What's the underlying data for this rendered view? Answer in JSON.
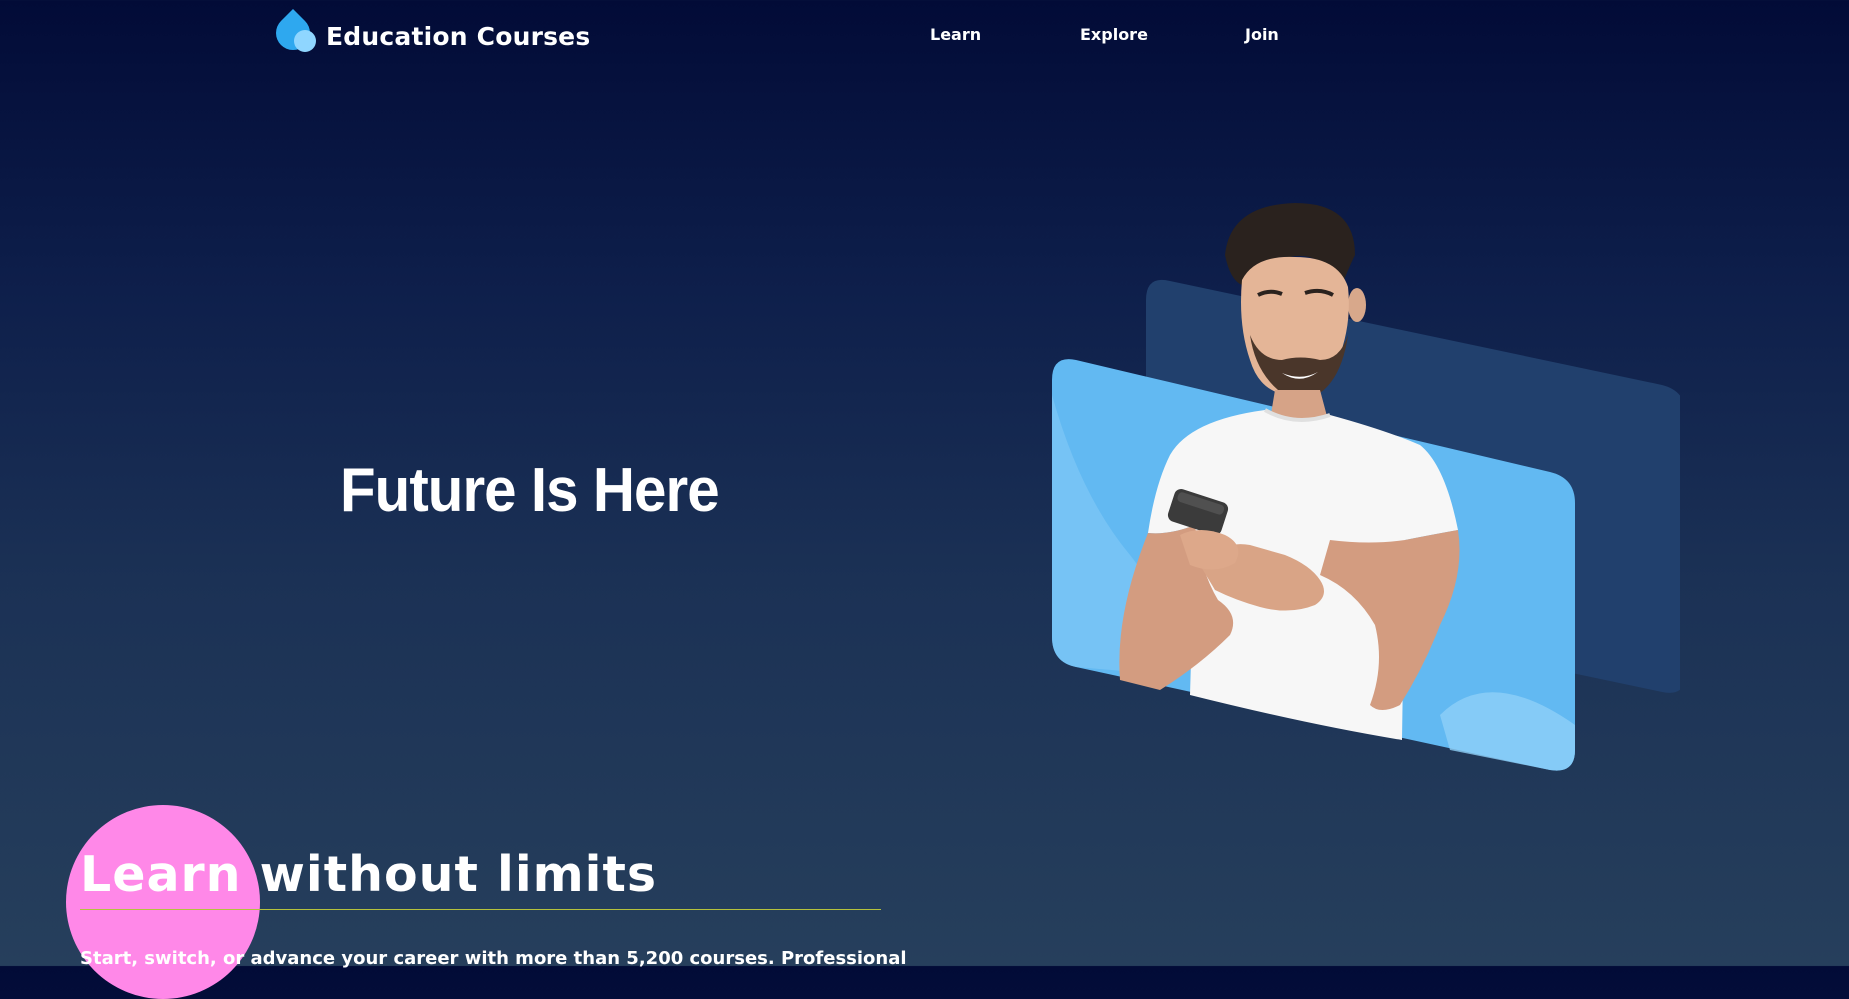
{
  "brand": {
    "name": "Education Courses",
    "logo_icon": "water-drop-icon",
    "logo_colors": [
      "#2ea8ef",
      "#8fd6ff"
    ]
  },
  "nav": {
    "items": [
      {
        "label": "Learn"
      },
      {
        "label": "Explore"
      },
      {
        "label": "Join"
      }
    ]
  },
  "hero": {
    "title": "Future Is Here",
    "image": "man-smiling-at-phone-photo",
    "panel_colors": {
      "front": "#62b9f2",
      "back": "#21406d"
    }
  },
  "section": {
    "title": "Learn without limits",
    "text": "Start, switch, or advance your career with more than 5,200 courses. Professional",
    "accent_circle_color": "#ff88e8",
    "rule_color": "#b5c23c"
  },
  "colors": {
    "background_top": "#020b37",
    "background_bottom": "#263f5c",
    "text": "#ffffff"
  }
}
